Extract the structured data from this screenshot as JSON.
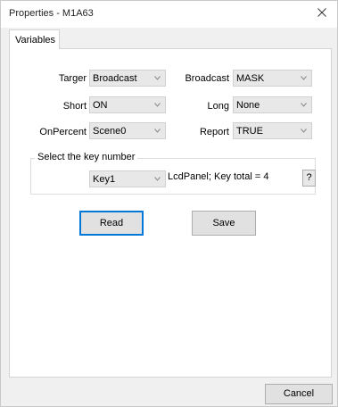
{
  "window": {
    "title": "Properties - M1A63"
  },
  "tabs": [
    {
      "label": "Variables"
    }
  ],
  "fields": {
    "targer": {
      "label": "Targer",
      "value": "Broadcast"
    },
    "broadcast": {
      "label": "Broadcast",
      "value": "MASK"
    },
    "short": {
      "label": "Short",
      "value": "ON"
    },
    "long": {
      "label": "Long",
      "value": "None"
    },
    "onpercent": {
      "label": "OnPercent",
      "value": "Scene0"
    },
    "report": {
      "label": "Report",
      "value": "TRUE"
    }
  },
  "key_group": {
    "title": "Select the key number",
    "key_value": "Key1",
    "info": "LcdPanel; Key total = 4",
    "help_label": "?"
  },
  "buttons": {
    "read": "Read",
    "save": "Save",
    "cancel": "Cancel"
  },
  "icons": {
    "close": "close-icon",
    "combo_arrow": "chevron-down-icon"
  }
}
